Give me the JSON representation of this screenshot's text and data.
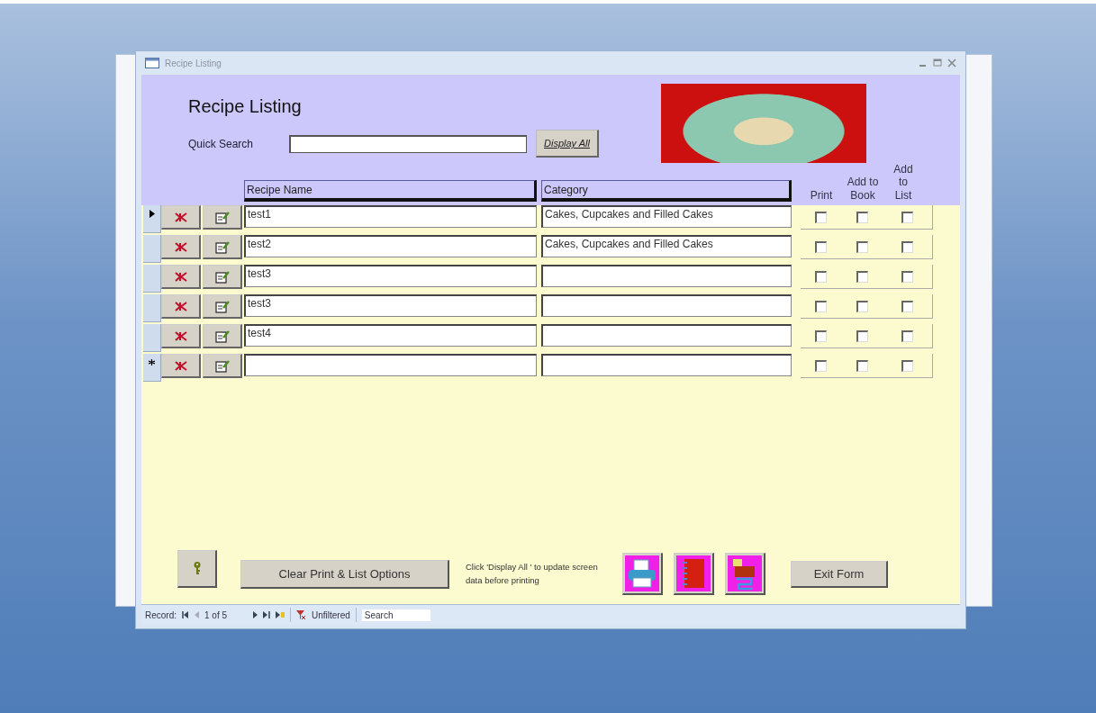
{
  "window": {
    "title": "Recipe Listing"
  },
  "header": {
    "title": "Recipe Listing",
    "search_label": "Quick Search",
    "display_all_button": "Display All"
  },
  "columns": {
    "name": "Recipe Name",
    "category": "Category",
    "print": "Print",
    "add_to_book": "Add to Book",
    "add_to_list": "Add to List"
  },
  "rows": [
    {
      "kind": "current",
      "name": "test1",
      "category": "Cakes, Cupcakes and Filled Cakes",
      "print": false,
      "add_to_book": false,
      "add_to_list": false
    },
    {
      "kind": "plain",
      "name": "test2",
      "category": "Cakes, Cupcakes and Filled Cakes",
      "print": false,
      "add_to_book": false,
      "add_to_list": false
    },
    {
      "kind": "plain",
      "name": "test3",
      "print": false,
      "add_to_book": false,
      "add_to_list": false
    },
    {
      "kind": "plain",
      "name": "test3",
      "print": false,
      "add_to_book": false,
      "add_to_list": false
    },
    {
      "kind": "plain",
      "name": "test4",
      "print": false,
      "add_to_book": false,
      "add_to_list": false
    },
    {
      "kind": "new",
      "print": false,
      "add_to_book": false,
      "add_to_list": false
    }
  ],
  "footer": {
    "clear_button": "Clear Print & List Options",
    "note": "Click 'Display All ' to update screen data before printing",
    "exit_button": "Exit Form"
  },
  "status_bar": {
    "record_label": "Record:",
    "position": "1 of 5",
    "filter": "Unfiltered",
    "search": "Search"
  }
}
